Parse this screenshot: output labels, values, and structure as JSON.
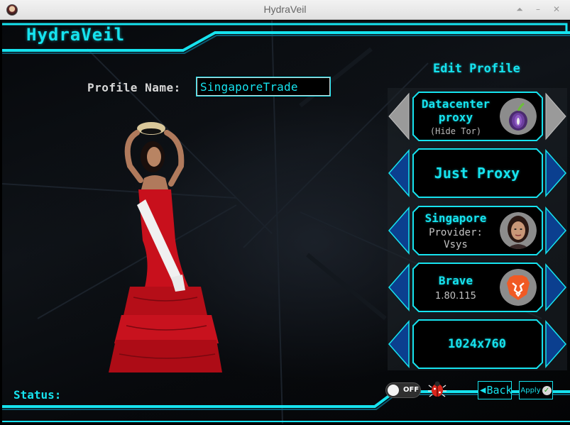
{
  "window": {
    "title": "HydraVeil",
    "controls": {
      "shade": "⏶",
      "minimize": "–",
      "close": "✕"
    }
  },
  "app": {
    "brand": "HydraVeil",
    "accent_color": "#16e3ef"
  },
  "profile": {
    "label": "Profile Name:",
    "name_value": "SingaporeTrade"
  },
  "panel": {
    "title": "Edit Profile",
    "rows": [
      {
        "title": "Datacenter proxy",
        "title_lines": [
          "Datacenter",
          "proxy"
        ],
        "subtitle": "(Hide Tor)",
        "icon": "tor-onion-icon",
        "arrow_style": "gray"
      },
      {
        "title": "Just Proxy",
        "icon": "",
        "arrow_style": "blue"
      },
      {
        "title": "Singapore",
        "subtitle_lines": [
          "Provider:",
          "Vsys"
        ],
        "icon": "avatar-portrait",
        "arrow_style": "blue"
      },
      {
        "title": "Brave",
        "subtitle": "1.80.115",
        "icon": "brave-lion-icon",
        "arrow_style": "blue"
      },
      {
        "title": "1024x760",
        "icon": "",
        "arrow_style": "blue"
      }
    ]
  },
  "status": {
    "label": "Status:",
    "value": ""
  },
  "footer": {
    "toggle_label": "OFF",
    "toggle_state": "off",
    "debug_icon": "bug-icon",
    "back_label": "Back",
    "apply_label": "Apply"
  }
}
